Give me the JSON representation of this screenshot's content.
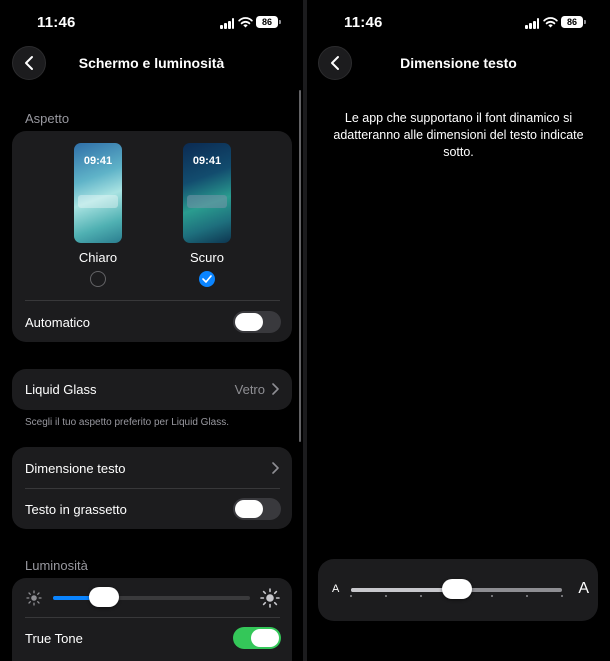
{
  "status_bar": {
    "time": "11:46",
    "battery": "86"
  },
  "left_screen": {
    "nav_title": "Schermo e luminosità",
    "appearance": {
      "section_label": "Aspetto",
      "light": {
        "preview_time": "09:41",
        "label": "Chiaro",
        "selected": false
      },
      "dark": {
        "preview_time": "09:41",
        "label": "Scuro",
        "selected": true
      },
      "automatic_label": "Automatico",
      "automatic_on": false
    },
    "liquid_glass": {
      "label": "Liquid Glass",
      "value": "Vetro",
      "footnote": "Scegli il tuo aspetto preferito per Liquid Glass."
    },
    "text": {
      "text_size_label": "Dimensione testo",
      "bold_label": "Testo in grassetto",
      "bold_on": false
    },
    "brightness": {
      "section_label": "Luminosità",
      "level": 0.26,
      "true_tone_label": "True Tone",
      "true_tone_on": true
    }
  },
  "right_screen": {
    "nav_title": "Dimensione testo",
    "info": "Le app che supportano il font dinamico si adatteranno alle dimensioni del testo indicate sotto.",
    "small_a": "A",
    "large_a": "A",
    "text_size_step": 3,
    "text_size_steps": 7
  },
  "colors": {
    "accent_blue": "#0a84ff",
    "toggle_green": "#34c759",
    "card_bg": "#1c1c1e",
    "secondary_text": "#98989f"
  }
}
